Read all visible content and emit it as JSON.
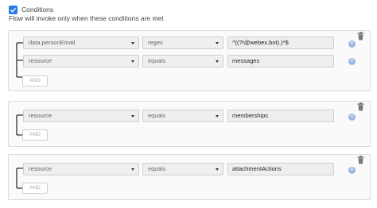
{
  "header": {
    "title": "Conditions",
    "subtitle": "Flow will invoke only when these conditions are met"
  },
  "groups": [
    {
      "rows": [
        {
          "field": "data.personEmail",
          "operator": "regex",
          "value": "^((?!@webex.bot).)*$"
        },
        {
          "field": "resource",
          "operator": "equals",
          "value": "messages"
        }
      ],
      "and_label": "AND"
    },
    {
      "rows": [
        {
          "field": "resource",
          "operator": "equals",
          "value": "memberships"
        }
      ],
      "and_label": "AND"
    },
    {
      "rows": [
        {
          "field": "resource",
          "operator": "equals",
          "value": "attachmentActions"
        }
      ],
      "and_label": "AND"
    }
  ],
  "colors": {
    "accent": "#2c7be5",
    "remove": "#9db7e3"
  }
}
